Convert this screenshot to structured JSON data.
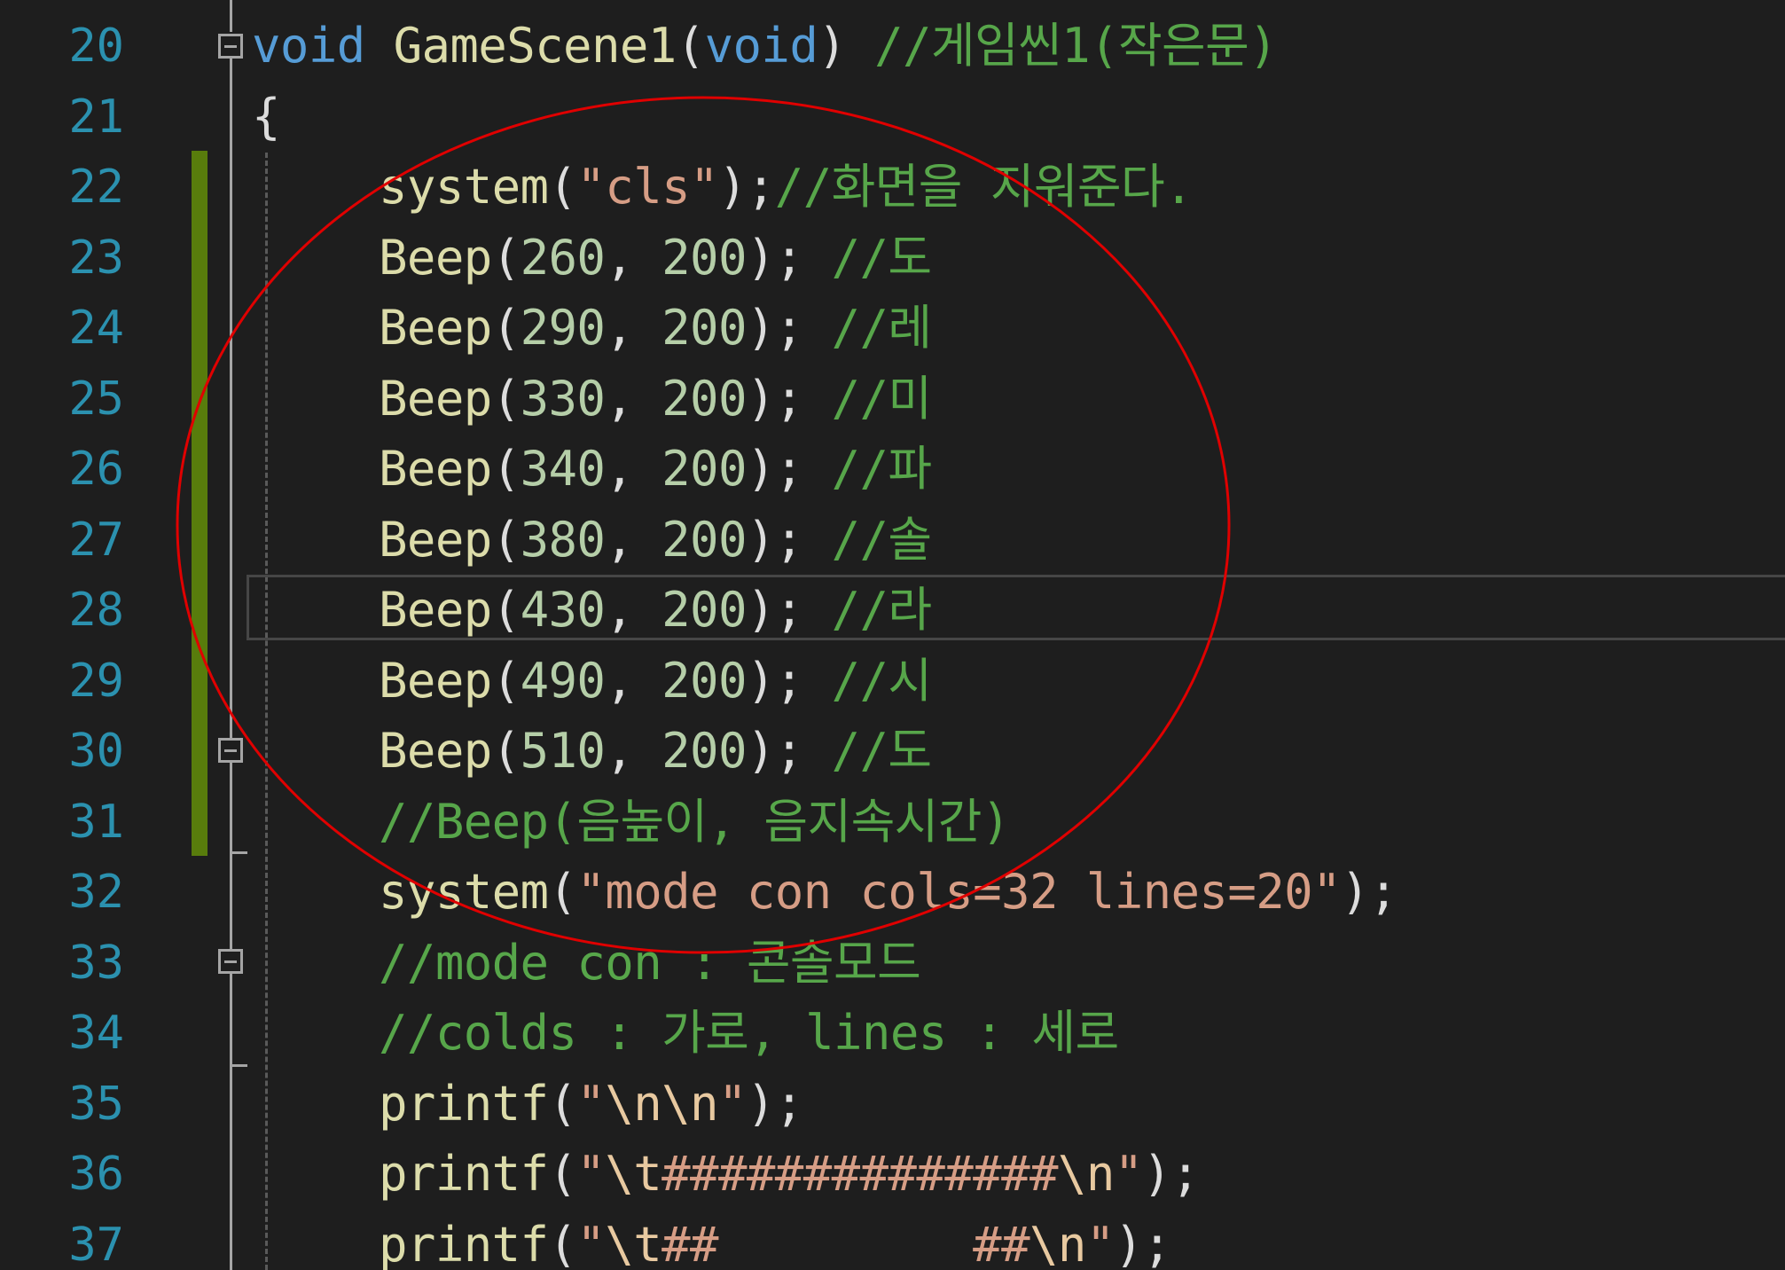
{
  "editor": {
    "lines": [
      {
        "number": "20",
        "tokens": [
          {
            "t": "void",
            "c": "kw"
          },
          {
            "t": " ",
            "c": "plain"
          },
          {
            "t": "GameScene1",
            "c": "fn"
          },
          {
            "t": "(",
            "c": "punc"
          },
          {
            "t": "void",
            "c": "kw"
          },
          {
            "t": ") ",
            "c": "punc"
          },
          {
            "t": "//게임씬1(작은문)",
            "c": "cmt"
          }
        ]
      },
      {
        "number": "21",
        "tokens": [
          {
            "t": "{",
            "c": "punc"
          }
        ]
      },
      {
        "number": "22",
        "tokens": [
          {
            "t": "system",
            "c": "fn"
          },
          {
            "t": "(",
            "c": "punc"
          },
          {
            "t": "\"cls\"",
            "c": "str"
          },
          {
            "t": ");",
            "c": "punc"
          },
          {
            "t": "//화면을 지워준다.",
            "c": "cmt"
          }
        ]
      },
      {
        "number": "23",
        "tokens": [
          {
            "t": "Beep",
            "c": "fn"
          },
          {
            "t": "(",
            "c": "punc"
          },
          {
            "t": "260",
            "c": "num"
          },
          {
            "t": ", ",
            "c": "punc"
          },
          {
            "t": "200",
            "c": "num"
          },
          {
            "t": "); ",
            "c": "punc"
          },
          {
            "t": "//도",
            "c": "cmt"
          }
        ]
      },
      {
        "number": "24",
        "tokens": [
          {
            "t": "Beep",
            "c": "fn"
          },
          {
            "t": "(",
            "c": "punc"
          },
          {
            "t": "290",
            "c": "num"
          },
          {
            "t": ", ",
            "c": "punc"
          },
          {
            "t": "200",
            "c": "num"
          },
          {
            "t": "); ",
            "c": "punc"
          },
          {
            "t": "//레",
            "c": "cmt"
          }
        ]
      },
      {
        "number": "25",
        "tokens": [
          {
            "t": "Beep",
            "c": "fn"
          },
          {
            "t": "(",
            "c": "punc"
          },
          {
            "t": "330",
            "c": "num"
          },
          {
            "t": ", ",
            "c": "punc"
          },
          {
            "t": "200",
            "c": "num"
          },
          {
            "t": "); ",
            "c": "punc"
          },
          {
            "t": "//미",
            "c": "cmt"
          }
        ]
      },
      {
        "number": "26",
        "tokens": [
          {
            "t": "Beep",
            "c": "fn"
          },
          {
            "t": "(",
            "c": "punc"
          },
          {
            "t": "340",
            "c": "num"
          },
          {
            "t": ", ",
            "c": "punc"
          },
          {
            "t": "200",
            "c": "num"
          },
          {
            "t": "); ",
            "c": "punc"
          },
          {
            "t": "//파",
            "c": "cmt"
          }
        ]
      },
      {
        "number": "27",
        "tokens": [
          {
            "t": "Beep",
            "c": "fn"
          },
          {
            "t": "(",
            "c": "punc"
          },
          {
            "t": "380",
            "c": "num"
          },
          {
            "t": ", ",
            "c": "punc"
          },
          {
            "t": "200",
            "c": "num"
          },
          {
            "t": "); ",
            "c": "punc"
          },
          {
            "t": "//솔",
            "c": "cmt"
          }
        ]
      },
      {
        "number": "28",
        "tokens": [
          {
            "t": "Beep",
            "c": "fn"
          },
          {
            "t": "(",
            "c": "punc"
          },
          {
            "t": "430",
            "c": "num"
          },
          {
            "t": ", ",
            "c": "punc"
          },
          {
            "t": "200",
            "c": "num"
          },
          {
            "t": "); ",
            "c": "punc"
          },
          {
            "t": "//라",
            "c": "cmt"
          }
        ]
      },
      {
        "number": "29",
        "tokens": [
          {
            "t": "Beep",
            "c": "fn"
          },
          {
            "t": "(",
            "c": "punc"
          },
          {
            "t": "490",
            "c": "num"
          },
          {
            "t": ", ",
            "c": "punc"
          },
          {
            "t": "200",
            "c": "num"
          },
          {
            "t": "); ",
            "c": "punc"
          },
          {
            "t": "//시",
            "c": "cmt"
          }
        ]
      },
      {
        "number": "30",
        "tokens": [
          {
            "t": "Beep",
            "c": "fn"
          },
          {
            "t": "(",
            "c": "punc"
          },
          {
            "t": "510",
            "c": "num"
          },
          {
            "t": ", ",
            "c": "punc"
          },
          {
            "t": "200",
            "c": "num"
          },
          {
            "t": "); ",
            "c": "punc"
          },
          {
            "t": "//도",
            "c": "cmt"
          }
        ]
      },
      {
        "number": "31",
        "tokens": [
          {
            "t": "//Beep(음높이, 음지속시간)",
            "c": "cmt"
          }
        ]
      },
      {
        "number": "32",
        "tokens": [
          {
            "t": "system",
            "c": "fn"
          },
          {
            "t": "(",
            "c": "punc"
          },
          {
            "t": "\"mode con cols=32 lines=20\"",
            "c": "str"
          },
          {
            "t": ");",
            "c": "punc"
          }
        ]
      },
      {
        "number": "33",
        "tokens": [
          {
            "t": "//mode con : 콘솔모드",
            "c": "cmt"
          }
        ]
      },
      {
        "number": "34",
        "tokens": [
          {
            "t": "//colds : 가로, lines : 세로",
            "c": "cmt"
          }
        ]
      },
      {
        "number": "35",
        "tokens": [
          {
            "t": "printf",
            "c": "fn"
          },
          {
            "t": "(",
            "c": "punc"
          },
          {
            "t": "\"",
            "c": "str"
          },
          {
            "t": "\\n\\n",
            "c": "esc"
          },
          {
            "t": "\"",
            "c": "str"
          },
          {
            "t": ");",
            "c": "punc"
          }
        ]
      },
      {
        "number": "36",
        "tokens": [
          {
            "t": "printf",
            "c": "fn"
          },
          {
            "t": "(",
            "c": "punc"
          },
          {
            "t": "\"",
            "c": "str"
          },
          {
            "t": "\\t",
            "c": "esc"
          },
          {
            "t": "##############",
            "c": "str"
          },
          {
            "t": "\\n",
            "c": "esc"
          },
          {
            "t": "\"",
            "c": "str"
          },
          {
            "t": ");",
            "c": "punc"
          }
        ]
      },
      {
        "number": "37",
        "tokens": [
          {
            "t": "printf",
            "c": "fn"
          },
          {
            "t": "(",
            "c": "punc"
          },
          {
            "t": "\"",
            "c": "str"
          },
          {
            "t": "\\t",
            "c": "esc"
          },
          {
            "t": "##         ##",
            "c": "str"
          },
          {
            "t": "\\n",
            "c": "esc"
          },
          {
            "t": "\"",
            "c": "str"
          },
          {
            "t": ");",
            "c": "punc"
          }
        ]
      }
    ]
  },
  "theme": {
    "background": "#1e1e1e",
    "line_number": "#2b91af",
    "change_bar": "#587c0c",
    "annotation_circle": "#e00000"
  }
}
